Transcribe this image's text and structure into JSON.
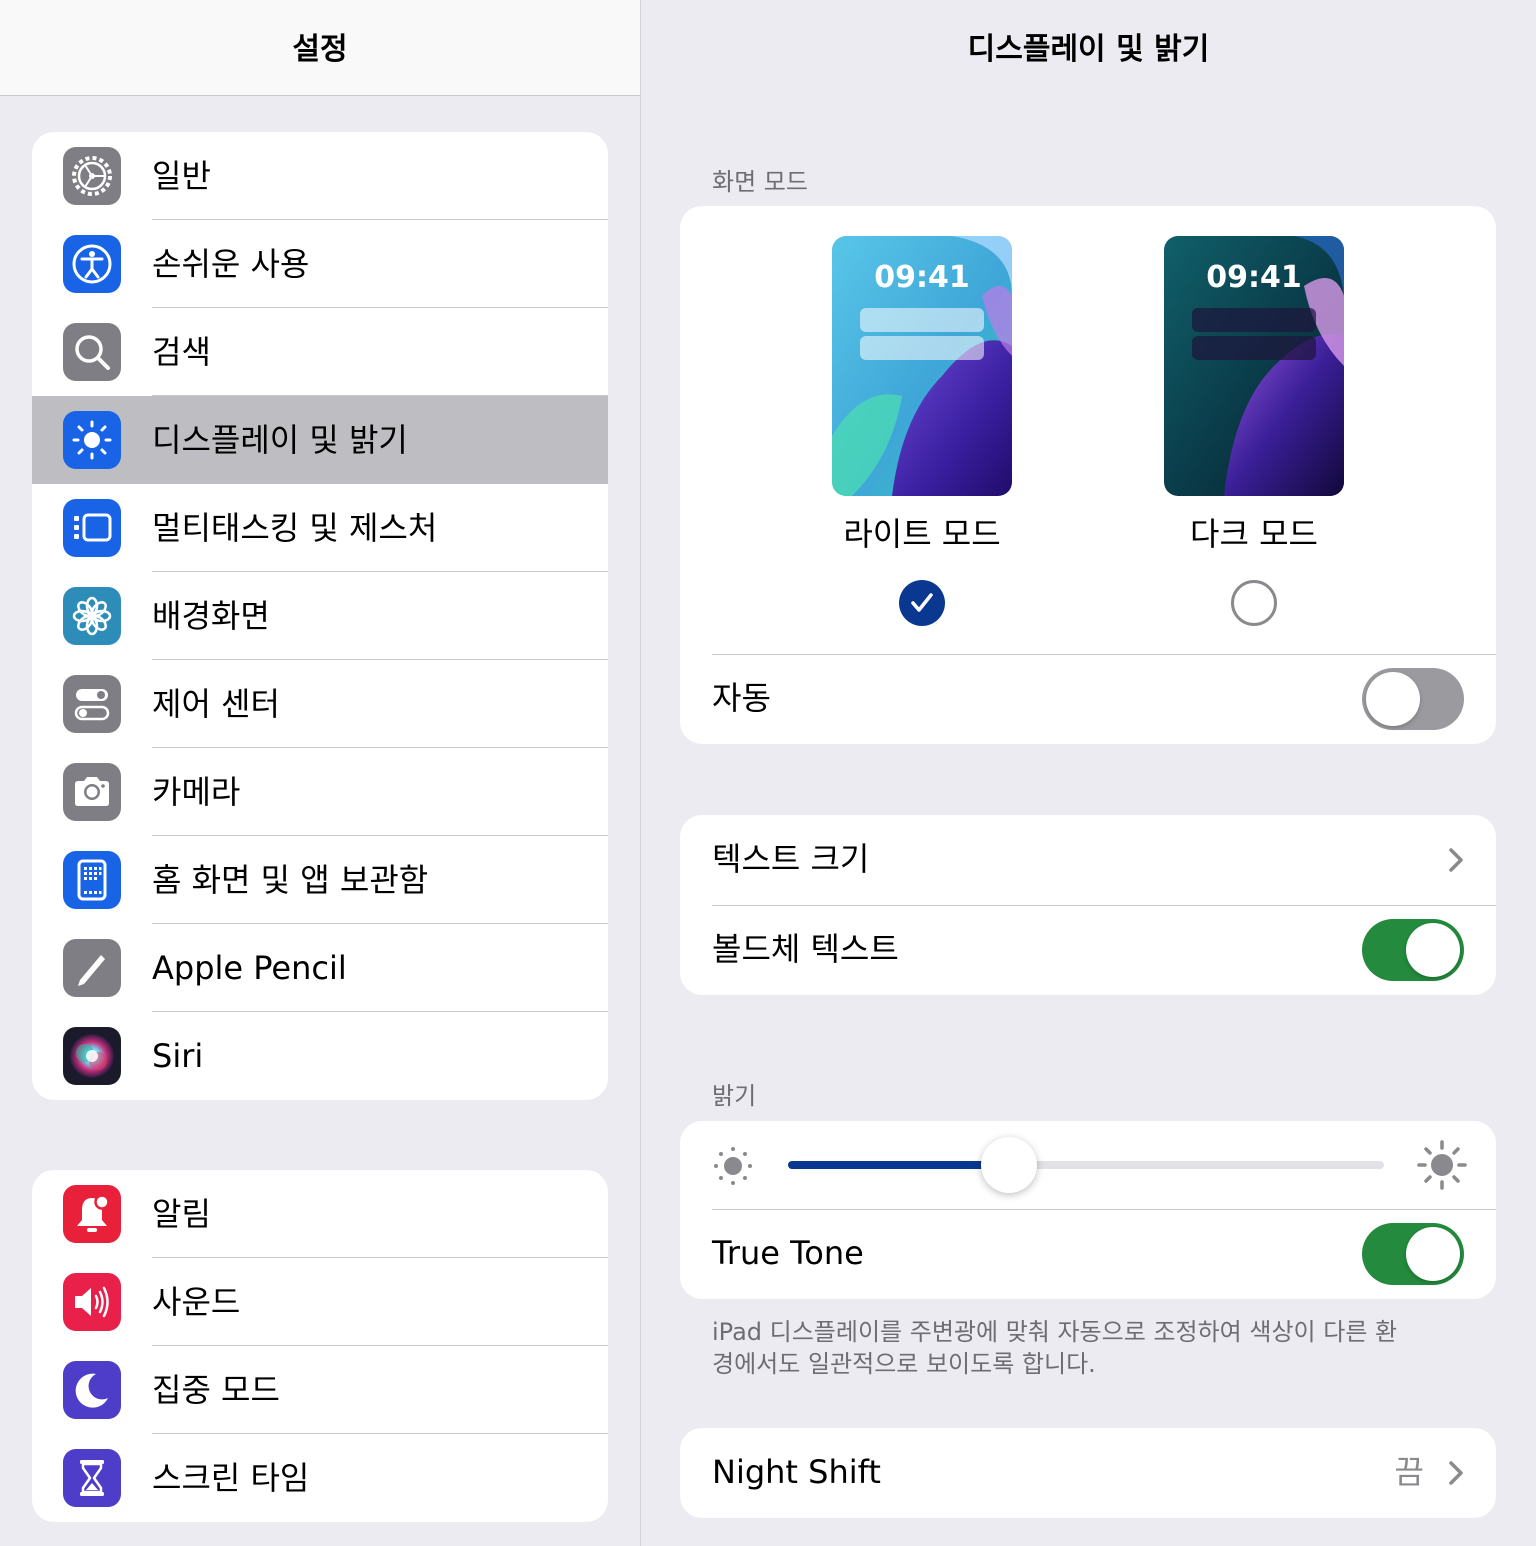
{
  "sidebar": {
    "title": "설정",
    "group1": [
      {
        "label": "일반",
        "icon": "gear-icon",
        "color": "#7E7E84"
      },
      {
        "label": "손쉬운 사용",
        "icon": "accessibility-icon",
        "color": "#1863E6"
      },
      {
        "label": "검색",
        "icon": "search-icon",
        "color": "#7E7E84"
      },
      {
        "label": "디스플레이 및 밝기",
        "icon": "sun-icon",
        "color": "#1863E6",
        "selected": true
      },
      {
        "label": "멀티태스킹 및 제스처",
        "icon": "multitasking-icon",
        "color": "#1863E6"
      },
      {
        "label": "배경화면",
        "icon": "flower-icon",
        "color": "#2E8CB8"
      },
      {
        "label": "제어 센터",
        "icon": "toggles-icon",
        "color": "#7E7E84"
      },
      {
        "label": "카메라",
        "icon": "camera-icon",
        "color": "#7E7E84"
      },
      {
        "label": "홈 화면 및 앱 보관함",
        "icon": "home-screen-icon",
        "color": "#1863E6"
      },
      {
        "label": "Apple Pencil",
        "icon": "pencil-icon",
        "color": "#7E7E84"
      },
      {
        "label": "Siri",
        "icon": "siri-icon",
        "color": "#1A1A2A"
      }
    ],
    "group2": [
      {
        "label": "알림",
        "icon": "bell-icon",
        "color": "#E8203A"
      },
      {
        "label": "사운드",
        "icon": "speaker-icon",
        "color": "#E8204A"
      },
      {
        "label": "집중 모드",
        "icon": "moon-icon",
        "color": "#4E3DC8"
      },
      {
        "label": "스크린 타임",
        "icon": "hourglass-icon",
        "color": "#4E3DC8"
      }
    ]
  },
  "main": {
    "title": "디스플레이 및 밝기",
    "appearance": {
      "header": "화면 모드",
      "light": {
        "label": "라이트 모드",
        "clock": "09:41",
        "selected": true
      },
      "dark": {
        "label": "다크 모드",
        "clock": "09:41",
        "selected": false
      },
      "auto_label": "자동",
      "auto_on": false
    },
    "text": {
      "text_size_label": "텍스트 크기",
      "bold_text_label": "볼드체 텍스트",
      "bold_on": true
    },
    "brightness": {
      "header": "밝기",
      "level": 0.37,
      "true_tone_label": "True Tone",
      "true_tone_on": true,
      "footnote": "iPad 디스플레이를 주변광에 맞춰 자동으로 조정하여 색상이 다른 환경에서도 일관적으로 보이도록 합니다."
    },
    "night_shift": {
      "label": "Night Shift",
      "value": "끔"
    }
  },
  "colors": {
    "accent": "#0A3890",
    "toggle_on": "#248A3D",
    "background": "#ECEBF1",
    "selected_row": "#BDBDC2"
  }
}
